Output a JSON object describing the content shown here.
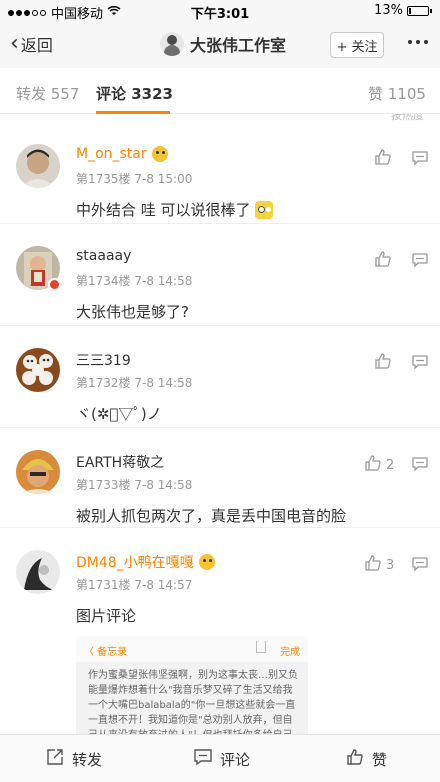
{
  "status_bar": {
    "carrier": "中国移动",
    "wifi_icon": "wifi-icon",
    "time": "下午3:01",
    "battery_percent": "13%",
    "battery_level": 0.13
  },
  "nav": {
    "back_label": "返回",
    "title": "大张伟工作室",
    "follow_label": "+ 关注"
  },
  "tabs": {
    "repost": "转发 557",
    "comment": "评论 3323",
    "like": "赞 1105"
  },
  "sort_hint": "按热度",
  "comments": [
    {
      "name": "M_on_star",
      "vip": true,
      "meta": "第1735楼 7-8 15:00",
      "text": "中外结合 哇 可以说很棒了",
      "like_count": ""
    },
    {
      "name": "staaaay",
      "vip": false,
      "meta": "第1734楼 7-8 14:58",
      "text": "大张伟也是够了?",
      "like_count": ""
    },
    {
      "name": "三三319",
      "vip": false,
      "meta": "第1732楼 7-8 14:58",
      "text": "ヾ(✲ﾟ▽ﾟ)ノ",
      "like_count": ""
    },
    {
      "name": "EARTH蒋敬之",
      "vip": false,
      "meta": "第1733楼 7-8 14:58",
      "text": "被别人抓包两次了，真是丢中国电音的脸",
      "like_count": "2"
    },
    {
      "name": "DM48_小鸭在嘎嘎",
      "vip": true,
      "meta": "第1731楼 7-8 14:57",
      "text": "图片评论",
      "like_count": "3"
    }
  ],
  "image_comment": {
    "back": "〈 备忘录",
    "done": "完成",
    "body": "作为蜜桑望张伟坚强啊，别为这事太丧…别又负能量爆炸想着什么\"我音乐梦又碎了生活又给我一个大嘴巴balabala的\"你一旦想这些就会一直一直想不开！我知道你是\"总劝别人放弃，但自己从来没有放弃过的人\"！但也拜托你多给自己一些积极的暗示！…这事儿呢，你是要重视把它妥善地解"
  },
  "bottom_bar": {
    "repost": "转发",
    "comment": "评论",
    "like": "赞"
  },
  "colors": {
    "accent": "#ff8200",
    "muted": "#999999"
  }
}
